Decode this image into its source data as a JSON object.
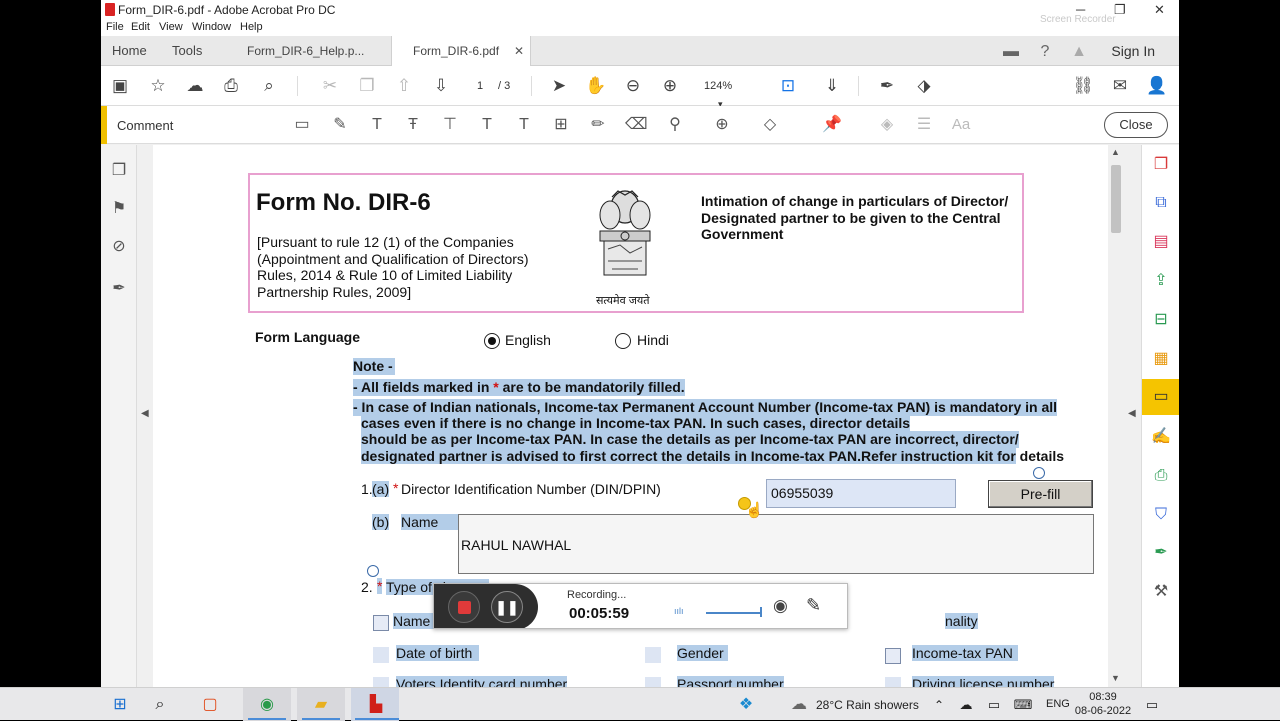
{
  "window": {
    "title": "Form_DIR-6.pdf - Adobe Acrobat Pro DC",
    "minimize": "─",
    "maximize": "❐",
    "close": "✕"
  },
  "menu": [
    "File",
    "Edit",
    "View",
    "Window",
    "Help"
  ],
  "tabs": {
    "home": "Home",
    "tools": "Tools",
    "doc1": "Form_DIR-6_Help.p...",
    "doc2": "Form_DIR-6.pdf",
    "close_glyph": "✕",
    "sign_in": "Sign In"
  },
  "toolbar": {
    "page_current": "1",
    "page_total": "/ 3",
    "zoom": "124%"
  },
  "comment_bar": {
    "label": "Comment",
    "close": "Close"
  },
  "watermark": "Screen Recorder",
  "document": {
    "form_title": "Form No. DIR-6",
    "pursuant": "[Pursuant to rule 12 (1) of the Companies (Appointment and Qualification of Directors) Rules, 2014 & Rule 10 of Limited Liability Partnership Rules, 2009]",
    "emblem_text": "सत्यमेव जयते",
    "intimation": "Intimation of change in particulars of Director/ Designated partner to be given to the Central Government",
    "form_language": "Form Language",
    "lang_english": "English",
    "lang_hindi": "Hindi",
    "note_title": "Note -",
    "note_line1_a": "- All fields marked in ",
    "note_line1_req": "*",
    "note_line1_b": " are to be mandatorily filled.",
    "note_line2": "- In case of Indian nationals, Income-tax Permanent Account Number (Income-tax PAN) is mandatory in all",
    "note_line3": "cases even if there is no change  in Income-tax PAN. In such cases, director details",
    "note_line4": "should be as per Income-tax PAN. In case the details as per Income-tax PAN are incorrect, director/",
    "note_line5_a": "designated partner is advised to first correct the details in Income-tax PAN.Refer instruction kit for",
    "note_line5_b": " details",
    "q1_num": "1.",
    "q1a": "(a)",
    "q1a_label": "Director Identification Number (DIN/DPIN)",
    "din_value": "06955039",
    "prefill": "Pre-fill",
    "q1b": "(b)",
    "q1b_label": "Name",
    "name_value": "RAHUL  NAWHAL",
    "q2_num": "2.",
    "q2_label": "Type of change:",
    "opt_name": "Name of director/ des",
    "opt_nationality": "nality",
    "opt_dob": "Date of birth",
    "opt_gender": "Gender",
    "opt_pan": "Income-tax PAN",
    "opt_voter": "Voters Identity card number",
    "opt_passport": "Passport number",
    "opt_license": "Driving license number",
    "required_mark": "*"
  },
  "recorder": {
    "status": "Recording...",
    "time": "00:05:59",
    "level": "ıılı"
  },
  "taskbar": {
    "weather": "28°C  Rain showers",
    "lang": "ENG",
    "time": "08:39",
    "date": "08-06-2022"
  }
}
